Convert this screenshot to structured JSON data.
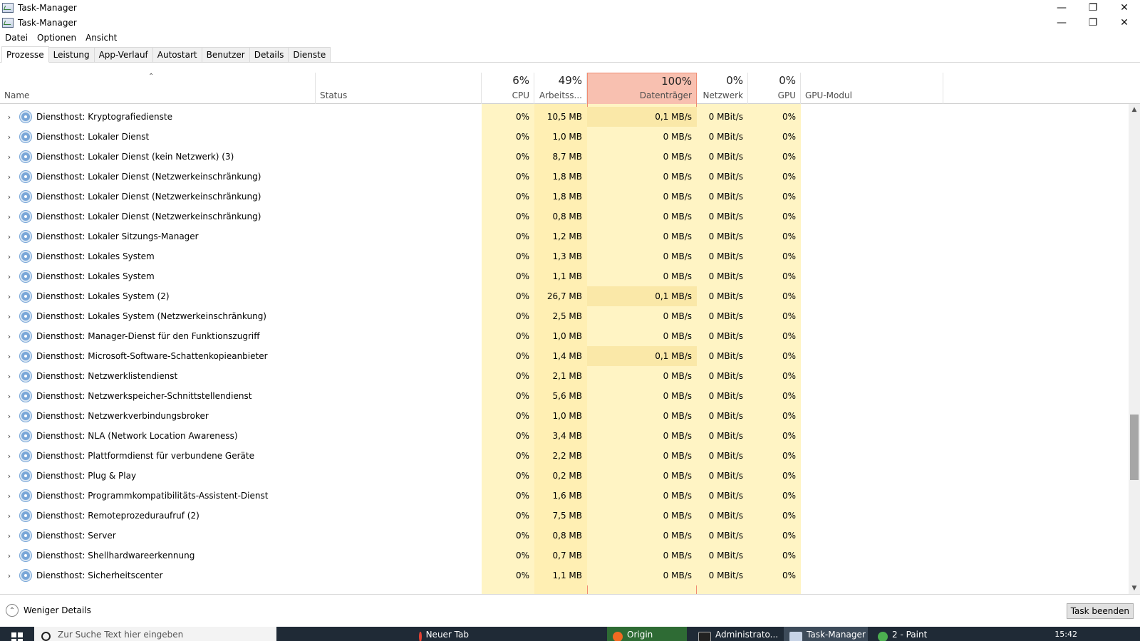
{
  "window": {
    "title": "Task-Manager",
    "controls": {
      "minimize": "—",
      "restore": "❐",
      "close": "✕"
    }
  },
  "menu": [
    "Datei",
    "Optionen",
    "Ansicht"
  ],
  "tabs": [
    {
      "label": "Prozesse",
      "active": true
    },
    {
      "label": "Leistung",
      "active": false
    },
    {
      "label": "App-Verlauf",
      "active": false
    },
    {
      "label": "Autostart",
      "active": false
    },
    {
      "label": "Benutzer",
      "active": false
    },
    {
      "label": "Details",
      "active": false
    },
    {
      "label": "Dienste",
      "active": false
    }
  ],
  "columns": {
    "name": "Name",
    "status": "Status",
    "cpu": {
      "pct": "6%",
      "label": "CPU"
    },
    "mem": {
      "pct": "49%",
      "label": "Arbeitss..."
    },
    "disk": {
      "pct": "100%",
      "label": "Datenträger"
    },
    "net": {
      "pct": "0%",
      "label": "Netzwerk"
    },
    "gpu": {
      "pct": "0%",
      "label": "GPU"
    },
    "gpu_engine": "GPU-Modul"
  },
  "rows": [
    {
      "name": "Diensthost: Kryptografiedienste",
      "cpu": "0%",
      "mem": "10,5 MB",
      "disk": "0,1 MB/s",
      "net": "0 MBit/s",
      "gpu": "0%"
    },
    {
      "name": "Diensthost: Lokaler Dienst",
      "cpu": "0%",
      "mem": "1,0 MB",
      "disk": "0 MB/s",
      "net": "0 MBit/s",
      "gpu": "0%"
    },
    {
      "name": "Diensthost: Lokaler Dienst (kein Netzwerk) (3)",
      "cpu": "0%",
      "mem": "8,7 MB",
      "disk": "0 MB/s",
      "net": "0 MBit/s",
      "gpu": "0%"
    },
    {
      "name": "Diensthost: Lokaler Dienst (Netzwerkeinschränkung)",
      "cpu": "0%",
      "mem": "1,8 MB",
      "disk": "0 MB/s",
      "net": "0 MBit/s",
      "gpu": "0%"
    },
    {
      "name": "Diensthost: Lokaler Dienst (Netzwerkeinschränkung)",
      "cpu": "0%",
      "mem": "1,8 MB",
      "disk": "0 MB/s",
      "net": "0 MBit/s",
      "gpu": "0%"
    },
    {
      "name": "Diensthost: Lokaler Dienst (Netzwerkeinschränkung)",
      "cpu": "0%",
      "mem": "0,8 MB",
      "disk": "0 MB/s",
      "net": "0 MBit/s",
      "gpu": "0%"
    },
    {
      "name": "Diensthost: Lokaler Sitzungs-Manager",
      "cpu": "0%",
      "mem": "1,2 MB",
      "disk": "0 MB/s",
      "net": "0 MBit/s",
      "gpu": "0%"
    },
    {
      "name": "Diensthost: Lokales System",
      "cpu": "0%",
      "mem": "1,3 MB",
      "disk": "0 MB/s",
      "net": "0 MBit/s",
      "gpu": "0%"
    },
    {
      "name": "Diensthost: Lokales System",
      "cpu": "0%",
      "mem": "1,1 MB",
      "disk": "0 MB/s",
      "net": "0 MBit/s",
      "gpu": "0%"
    },
    {
      "name": "Diensthost: Lokales System (2)",
      "cpu": "0%",
      "mem": "26,7 MB",
      "disk": "0,1 MB/s",
      "net": "0 MBit/s",
      "gpu": "0%"
    },
    {
      "name": "Diensthost: Lokales System (Netzwerkeinschränkung)",
      "cpu": "0%",
      "mem": "2,5 MB",
      "disk": "0 MB/s",
      "net": "0 MBit/s",
      "gpu": "0%"
    },
    {
      "name": "Diensthost: Manager-Dienst für den Funktionszugriff",
      "cpu": "0%",
      "mem": "1,0 MB",
      "disk": "0 MB/s",
      "net": "0 MBit/s",
      "gpu": "0%"
    },
    {
      "name": "Diensthost: Microsoft-Software-Schattenkopieanbieter",
      "cpu": "0%",
      "mem": "1,4 MB",
      "disk": "0,1 MB/s",
      "net": "0 MBit/s",
      "gpu": "0%"
    },
    {
      "name": "Diensthost: Netzwerklistendienst",
      "cpu": "0%",
      "mem": "2,1 MB",
      "disk": "0 MB/s",
      "net": "0 MBit/s",
      "gpu": "0%"
    },
    {
      "name": "Diensthost: Netzwerkspeicher-Schnittstellendienst",
      "cpu": "0%",
      "mem": "5,6 MB",
      "disk": "0 MB/s",
      "net": "0 MBit/s",
      "gpu": "0%"
    },
    {
      "name": "Diensthost: Netzwerkverbindungsbroker",
      "cpu": "0%",
      "mem": "1,0 MB",
      "disk": "0 MB/s",
      "net": "0 MBit/s",
      "gpu": "0%"
    },
    {
      "name": "Diensthost: NLA (Network Location Awareness)",
      "cpu": "0%",
      "mem": "3,4 MB",
      "disk": "0 MB/s",
      "net": "0 MBit/s",
      "gpu": "0%"
    },
    {
      "name": "Diensthost: Plattformdienst für verbundene Geräte",
      "cpu": "0%",
      "mem": "2,2 MB",
      "disk": "0 MB/s",
      "net": "0 MBit/s",
      "gpu": "0%"
    },
    {
      "name": "Diensthost: Plug & Play",
      "cpu": "0%",
      "mem": "0,2 MB",
      "disk": "0 MB/s",
      "net": "0 MBit/s",
      "gpu": "0%"
    },
    {
      "name": "Diensthost: Programmkompatibilitäts-Assistent-Dienst",
      "cpu": "0%",
      "mem": "1,6 MB",
      "disk": "0 MB/s",
      "net": "0 MBit/s",
      "gpu": "0%"
    },
    {
      "name": "Diensthost: Remoteprozeduraufruf (2)",
      "cpu": "0%",
      "mem": "7,5 MB",
      "disk": "0 MB/s",
      "net": "0 MBit/s",
      "gpu": "0%"
    },
    {
      "name": "Diensthost: Server",
      "cpu": "0%",
      "mem": "0,8 MB",
      "disk": "0 MB/s",
      "net": "0 MBit/s",
      "gpu": "0%"
    },
    {
      "name": "Diensthost: Shellhardwareerkennung",
      "cpu": "0%",
      "mem": "0,7 MB",
      "disk": "0 MB/s",
      "net": "0 MBit/s",
      "gpu": "0%"
    },
    {
      "name": "Diensthost: Sicherheitscenter",
      "cpu": "0%",
      "mem": "1,1 MB",
      "disk": "0 MB/s",
      "net": "0 MBit/s",
      "gpu": "0%"
    }
  ],
  "footer": {
    "fewer_details": "Weniger Details",
    "end_task": "Task beenden"
  },
  "taskbar": {
    "search_placeholder": "Zur Suche Text hier eingeben",
    "items": [
      "Neuer Tab",
      "Origin",
      "Administrato...",
      "Task-Manager",
      "2 - Paint"
    ],
    "time": "15:42"
  },
  "colors": {
    "disk_header_bg": "#f8c0b0",
    "usage_bg": "#fff4c4",
    "taskbar_bg": "#1f2a36"
  }
}
